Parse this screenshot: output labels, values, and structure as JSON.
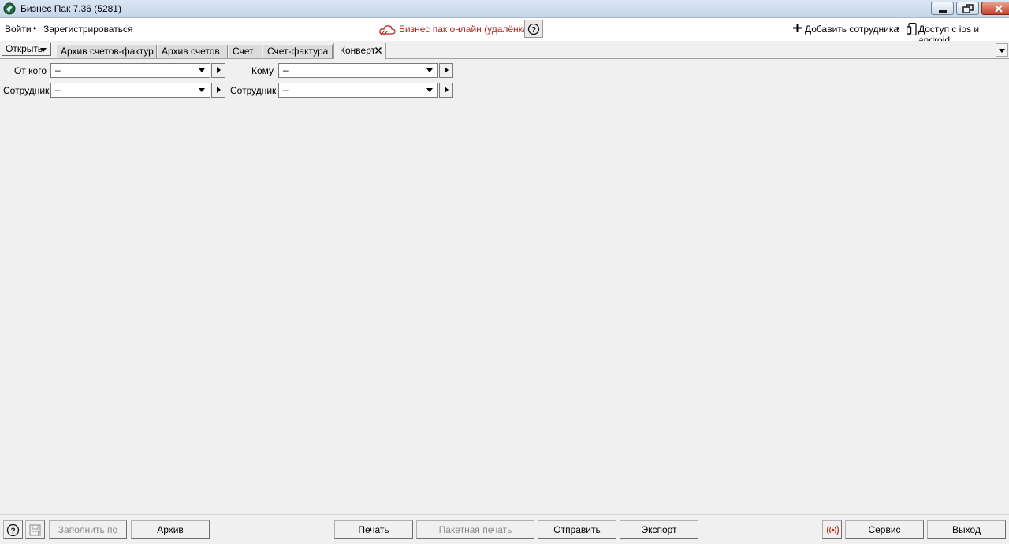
{
  "window": {
    "title": "Бизнес Пак 7.36 (5281)"
  },
  "menubar": {
    "login": "Войти",
    "separator": "•",
    "register": "Зарегистрироваться",
    "online": "Бизнес пак онлайн (удалёнка)",
    "add_employee": "Добавить сотрудника",
    "mobile_access": "Доступ с ios и android"
  },
  "tabs": {
    "open_label": "Открыть",
    "items": [
      {
        "label": "Архив счетов-фактур"
      },
      {
        "label": "Архив счетов"
      },
      {
        "label": "Счет"
      },
      {
        "label": "Счет-фактура"
      },
      {
        "label": "Конверт"
      }
    ],
    "active_index": 4
  },
  "form": {
    "from_label": "От кого",
    "from_value": "–",
    "to_label": "Кому",
    "to_value": "–",
    "employee_label_left": "Сотрудник",
    "employee_value_left": "–",
    "employee_label_right": "Сотрудник",
    "employee_value_right": "–"
  },
  "bottombar": {
    "fill_by": "Заполнить по",
    "archive": "Архив",
    "print": "Печать",
    "batch_print": "Пакетная печать",
    "send": "Отправить",
    "export": "Экспорт",
    "service": "Сервис",
    "exit": "Выход"
  },
  "colors": {
    "online_text": "#b02418",
    "background": "#f0f0f0"
  },
  "icons": {
    "app": "app-logo-icon",
    "online": "cloud-icon",
    "help": "help-icon",
    "add": "plus-icon",
    "mobile": "phone-icon",
    "save": "save-icon",
    "broadcast": "broadcast-icon"
  }
}
